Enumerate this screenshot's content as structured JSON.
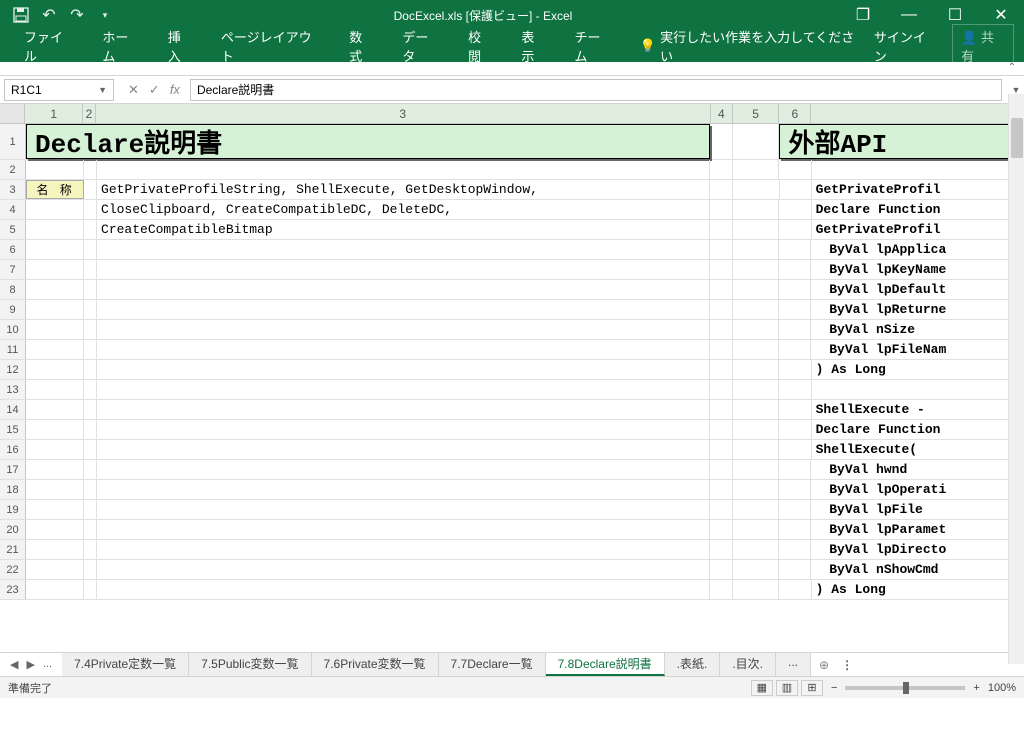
{
  "title": "DocExcel.xls [保護ビュー] - Excel",
  "qat": {
    "undo": "↶",
    "redo": "↷",
    "dropdown": "▾"
  },
  "winbtns": {
    "restore": "❐",
    "minimize": "—",
    "maximize": "☐",
    "close": "✕"
  },
  "ribbon": {
    "tabs": [
      "ファイル",
      "ホーム",
      "挿入",
      "ページレイアウト",
      "数式",
      "データ",
      "校閲",
      "表示",
      "チーム"
    ],
    "tellme_icon": "💡",
    "tellme": "実行したい作業を入力してください",
    "signin": "サインイン",
    "share_icon": "👤",
    "share": "共有"
  },
  "formulabar": {
    "namebox": "R1C1",
    "fx": "fx",
    "value": "Declare説明書"
  },
  "columns": [
    "1",
    "2",
    "3",
    "4",
    "5",
    "6"
  ],
  "rows": [
    "1",
    "2",
    "3",
    "4",
    "5",
    "6",
    "7",
    "8",
    "9",
    "10",
    "11",
    "12",
    "13",
    "14",
    "15",
    "16",
    "17",
    "18",
    "19",
    "20",
    "21",
    "22",
    "23"
  ],
  "main": {
    "title": "Declare説明書",
    "right_title": "外部API",
    "name_label": "名 称",
    "names": [
      "GetPrivateProfileString, ShellExecute, GetDesktopWindow,",
      "CloseClipboard, CreateCompatibleDC, DeleteDC,",
      "CreateCompatibleBitmap"
    ],
    "right_block": [
      {
        "t": "GetPrivateProfil",
        "b": true,
        "i": false
      },
      {
        "t": "Declare Function",
        "b": true,
        "i": false
      },
      {
        "t": "GetPrivateProfil",
        "b": true,
        "i": false
      },
      {
        "t": "ByVal lpApplica",
        "b": true,
        "i": true
      },
      {
        "t": "ByVal lpKeyName",
        "b": true,
        "i": true
      },
      {
        "t": "ByVal lpDefault",
        "b": true,
        "i": true
      },
      {
        "t": "ByVal lpReturne",
        "b": true,
        "i": true
      },
      {
        "t": "ByVal nSize",
        "b": true,
        "i": true
      },
      {
        "t": "ByVal lpFileNam",
        "b": true,
        "i": true
      },
      {
        "t": ") As Long",
        "b": true,
        "i": false
      },
      {
        "t": "",
        "b": false,
        "i": false
      },
      {
        "t": "ShellExecute - ",
        "b": true,
        "i": false
      },
      {
        "t": "Declare Function",
        "b": true,
        "i": false
      },
      {
        "t": "ShellExecute(",
        "b": true,
        "i": false
      },
      {
        "t": "ByVal hwnd",
        "b": true,
        "i": true
      },
      {
        "t": "ByVal lpOperati",
        "b": true,
        "i": true
      },
      {
        "t": "ByVal lpFile",
        "b": true,
        "i": true
      },
      {
        "t": "ByVal lpParamet",
        "b": true,
        "i": true
      },
      {
        "t": "ByVal lpDirecto",
        "b": true,
        "i": true
      },
      {
        "t": "ByVal nShowCmd",
        "b": true,
        "i": true
      },
      {
        "t": ") As Long",
        "b": true,
        "i": false
      }
    ]
  },
  "sheets": {
    "nav": [
      "◀",
      "▶",
      "..."
    ],
    "tabs": [
      "7.4Private定数一覧",
      "7.5Public変数一覧",
      "7.6Private変数一覧",
      "7.7Declare一覧",
      "7.8Declare説明書",
      ".表紙.",
      ".目次.",
      "..."
    ],
    "active_index": 4,
    "add": "⊕",
    "more": "⋮"
  },
  "status": {
    "ready": "準備完了",
    "zoom": "100%",
    "minus": "−",
    "plus": "+"
  }
}
